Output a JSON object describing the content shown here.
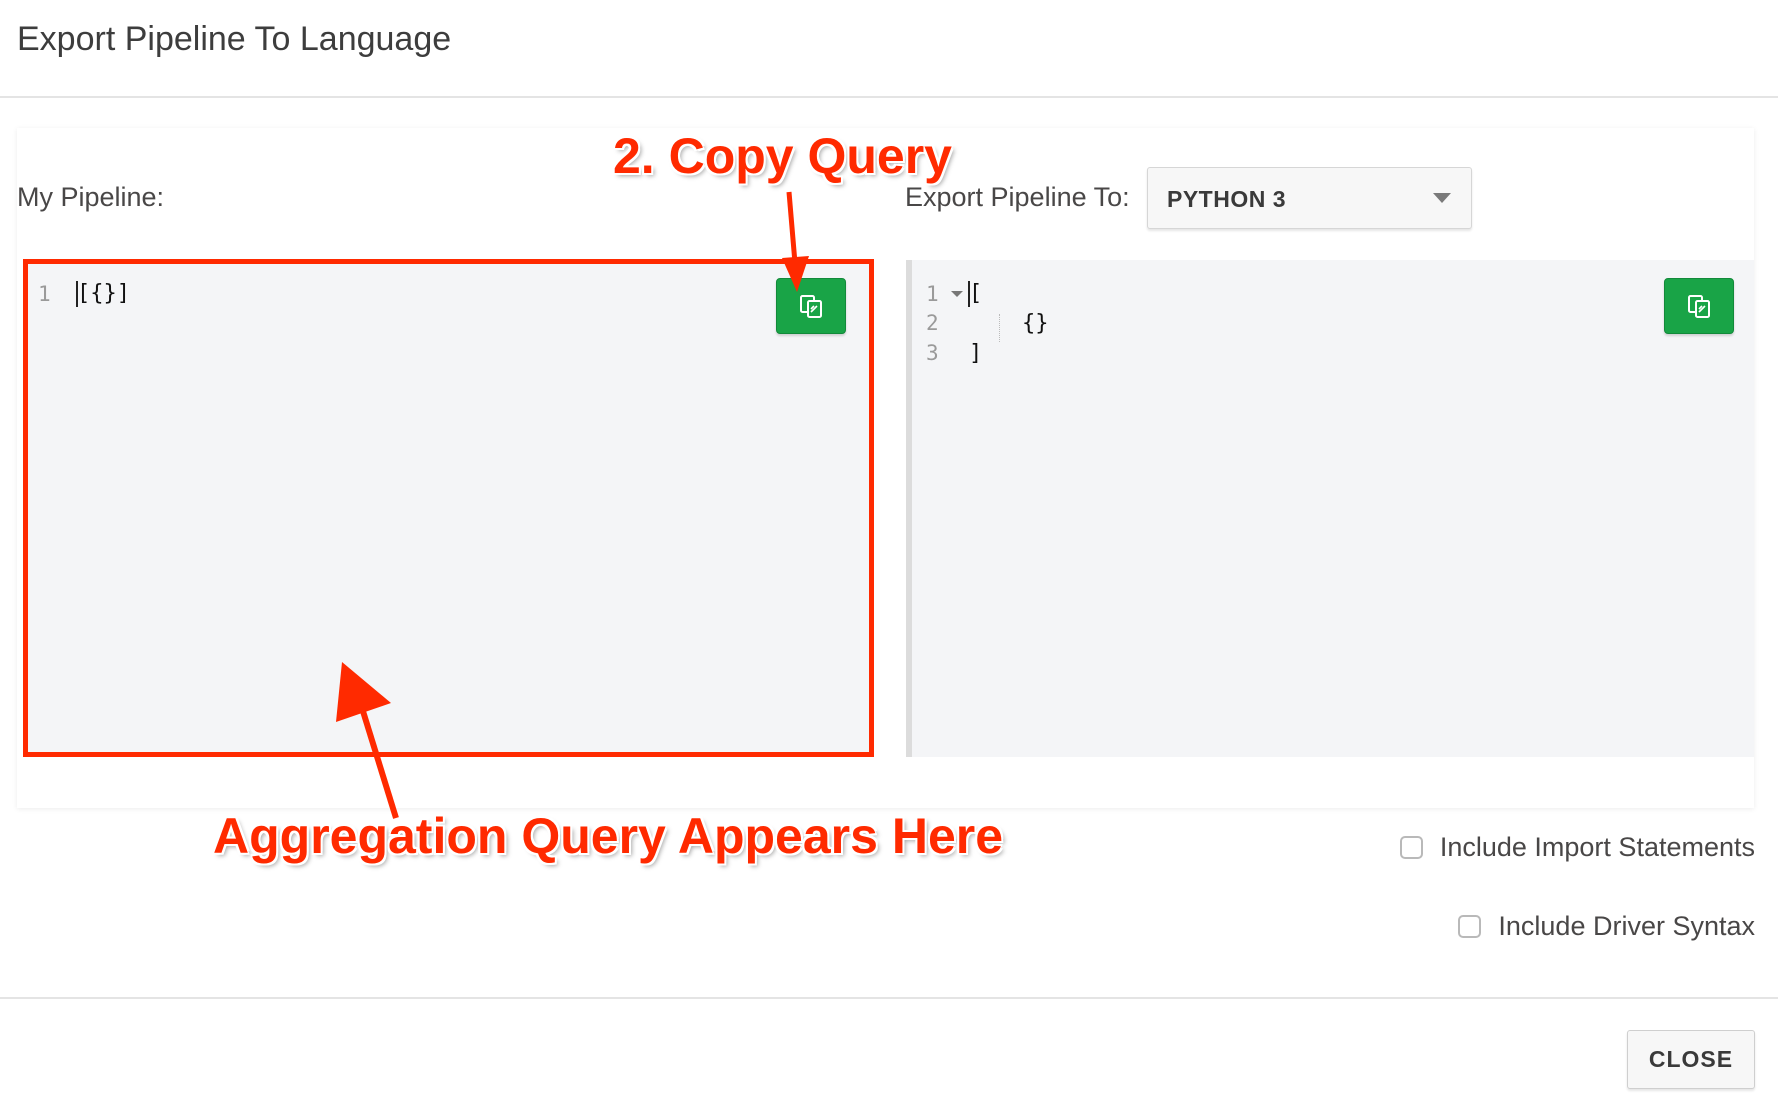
{
  "modal": {
    "title": "Export Pipeline To Language",
    "close_label": "CLOSE"
  },
  "left_panel": {
    "label": "My Pipeline:",
    "lines": [
      {
        "number": "1",
        "code": "[{}]"
      }
    ]
  },
  "right_panel": {
    "label": "Export Pipeline To:",
    "language_selected": "PYTHON 3",
    "lines": [
      {
        "number": "1",
        "code": "["
      },
      {
        "number": "2",
        "code": "{}"
      },
      {
        "number": "3",
        "code": "]"
      }
    ]
  },
  "options": {
    "include_import_label": "Include Import Statements",
    "include_import_checked": false,
    "include_driver_label": "Include Driver Syntax",
    "include_driver_checked": false
  },
  "annotations": {
    "copy_query": "2. Copy Query",
    "aggregation_query": "Aggregation Query Appears Here",
    "color": "#ff2a00"
  },
  "icons": {
    "copy": "copy-icon",
    "dropdown": "caret-down-icon",
    "fold": "fold-caret-icon"
  },
  "colors": {
    "copy_button": "#19a447",
    "editor_bg": "#f4f5f7",
    "annotation": "#ff2a00"
  }
}
